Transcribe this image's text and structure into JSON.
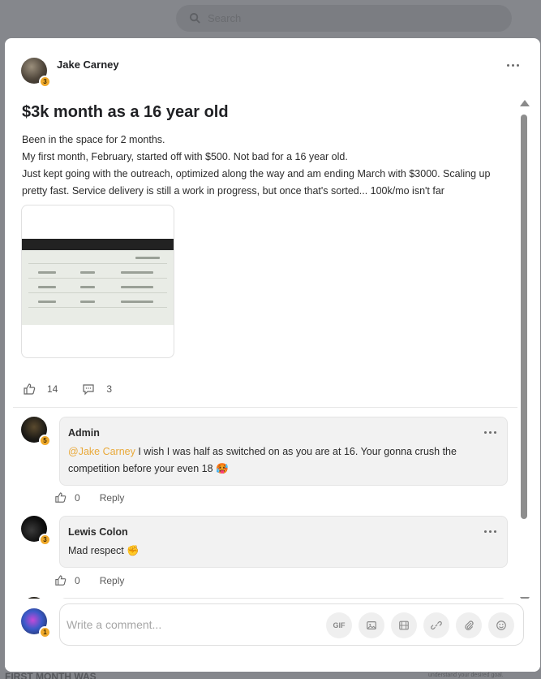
{
  "background": {
    "search_placeholder": "Search",
    "bottom_left_text": "FIRST MONTH WAS",
    "bottom_right_text": "understand your desired goal."
  },
  "post": {
    "author": {
      "name": "Jake Carney",
      "level": "3"
    },
    "title": "$3k month as a 16 year old",
    "body_lines": [
      "Been in the space for 2 months.",
      "My first month, February, started off with $500. Not bad for a 16 year old.",
      "Just kept going with the outreach, optimized along the way and am ending March with $3000. Scaling up pretty fast. Service delivery is still a work in progress, but once that's sorted... 100k/mo isn't far"
    ],
    "likes": "14",
    "comments": "3"
  },
  "comments": [
    {
      "author": "Admin",
      "level": "5",
      "mention": "@Jake Carney",
      "text": " I wish I was half as switched on as you are at 16. Your gonna crush the competition before your even 18 🥵",
      "likes": "0",
      "reply_label": "Reply"
    },
    {
      "author": "Lewis Colon",
      "level": "3",
      "text": "Mad respect ✊",
      "likes": "0",
      "reply_label": "Reply"
    }
  ],
  "composer": {
    "placeholder": "Write a comment...",
    "level": "1",
    "gif_label": "GIF"
  },
  "icons": {
    "search": "search-icon",
    "more": "more-dots-icon",
    "like": "thumbs-up-icon",
    "comment": "comment-bubble-icon",
    "image": "image-icon",
    "video": "film-icon",
    "link": "link-icon",
    "attach": "paperclip-icon",
    "emoji": "emoji-icon"
  },
  "colors": {
    "accent_mention": "#e9a93a",
    "level_badge": "#f0a92a"
  }
}
